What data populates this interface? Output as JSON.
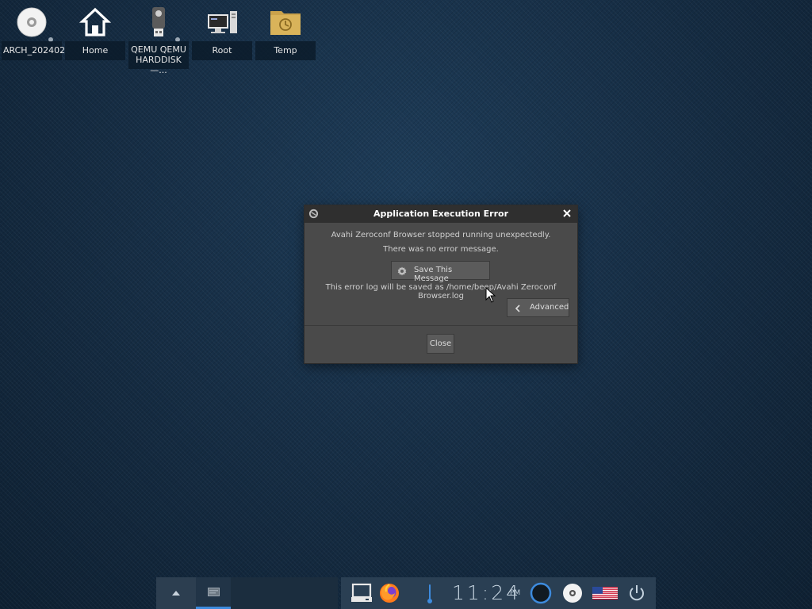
{
  "desktop": {
    "icons": [
      {
        "label": "ARCH_202402",
        "icon": "optical-disc-icon"
      },
      {
        "label": "Home",
        "icon": "home-icon"
      },
      {
        "label": "QEMU QEMU HARDDISK—...",
        "icon": "usb-drive-icon"
      },
      {
        "label": "Root",
        "icon": "computer-icon"
      },
      {
        "label": "Temp",
        "icon": "folder-clock-icon"
      }
    ]
  },
  "dialog": {
    "title": "Application Execution Error",
    "message_line1": "Avahi Zeroconf Browser stopped running unexpectedly.",
    "message_line2": "There was no error message.",
    "save_button": "Save This Message",
    "log_path_line": "This error log will be saved as /home/beep/Avahi Zeroconf Browser.log",
    "advanced_button": "Advanced",
    "close_button": "Close"
  },
  "taskbar": {
    "clock": {
      "time": "11:24",
      "ampm": "PM"
    },
    "accent_color": "#3d8bde"
  }
}
